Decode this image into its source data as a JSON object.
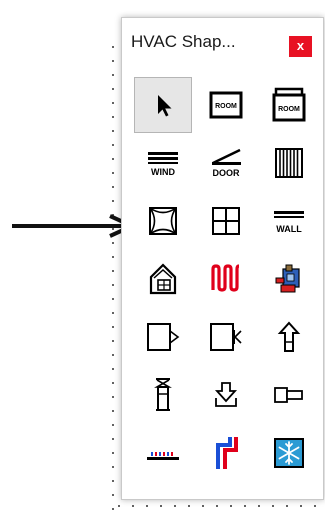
{
  "window": {
    "title": "HVAC Shap...",
    "close_label": "x"
  },
  "tools": [
    {
      "icon": "pointer-icon"
    },
    {
      "icon": "room-icon",
      "label": "ROOM"
    },
    {
      "icon": "room-stack-icon",
      "label": "ROOM"
    },
    {
      "icon": "window-icon",
      "label": "WIND"
    },
    {
      "icon": "door-icon",
      "label": "DOOR"
    },
    {
      "icon": "wall-vertical-icon"
    },
    {
      "icon": "diffuser-icon"
    },
    {
      "icon": "grid-register-icon"
    },
    {
      "icon": "wall-icon",
      "label": "WALL"
    },
    {
      "icon": "house-icon"
    },
    {
      "icon": "heating-coil-icon"
    },
    {
      "icon": "pump-unit-icon"
    },
    {
      "icon": "damper-right-icon"
    },
    {
      "icon": "damper-stop-icon"
    },
    {
      "icon": "up-arrow-icon"
    },
    {
      "icon": "vent-icon"
    },
    {
      "icon": "down-outlet-icon"
    },
    {
      "icon": "duct-connector-icon"
    },
    {
      "icon": "floor-heater-icon"
    },
    {
      "icon": "hot-cold-pipe-icon"
    },
    {
      "icon": "snowflake-icon"
    }
  ],
  "selected_tool": "pointer-icon"
}
